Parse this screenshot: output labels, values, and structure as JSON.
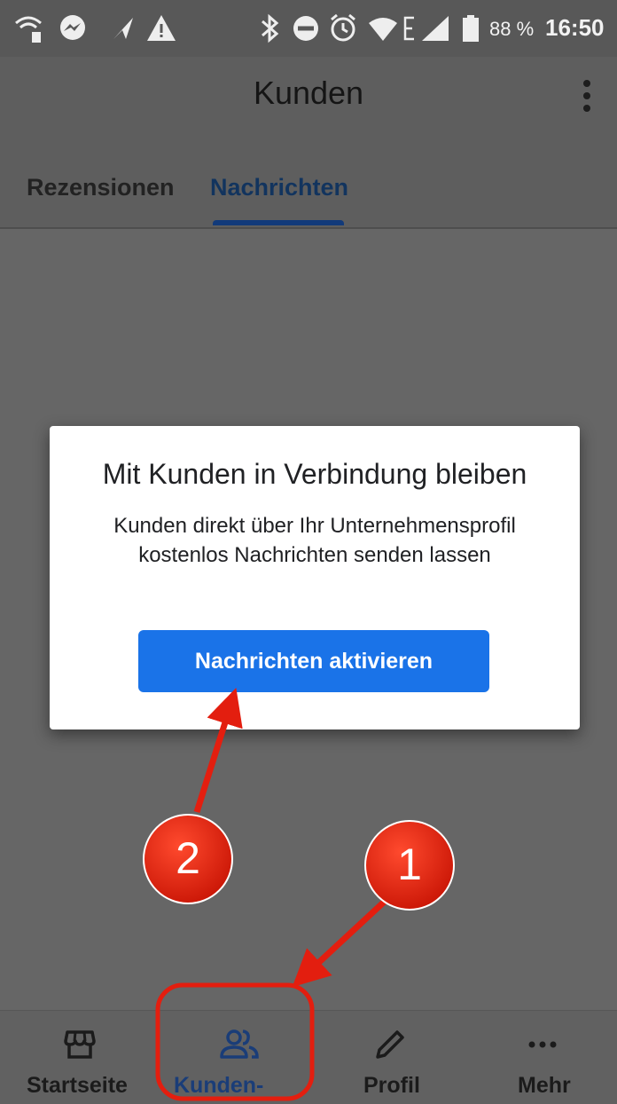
{
  "status_bar": {
    "battery": "88 %",
    "time": "16:50",
    "icons": [
      "wifi-calling-icon",
      "messenger-icon",
      "navigation-icon",
      "warning-icon",
      "bluetooth-icon",
      "do-not-disturb-icon",
      "alarm-icon",
      "wifi-icon",
      "network-e-icon",
      "signal-icon",
      "battery-icon"
    ]
  },
  "app_bar": {
    "title": "Kunden",
    "overflow_icon": "more-vert-icon"
  },
  "tabs": [
    {
      "label": "Rezensionen",
      "selected": false
    },
    {
      "label": "Nachrichten",
      "selected": true
    }
  ],
  "dialog": {
    "title": "Mit Kunden in Verbindung bleiben",
    "body": "Kunden direkt über Ihr Unternehmensprofil kostenlos Nachrichten senden lassen",
    "button_label": "Nachrichten aktivieren"
  },
  "bottom_nav": {
    "items": [
      {
        "label": "Startseite",
        "icon": "storefront-icon",
        "selected": false
      },
      {
        "label": "Kunden-",
        "icon": "people-icon",
        "selected": true
      },
      {
        "label": "Profil",
        "icon": "pencil-icon",
        "selected": false
      },
      {
        "label": "Mehr",
        "icon": "more-horiz-icon",
        "selected": false
      }
    ]
  },
  "annotations": {
    "badge_1": "1",
    "badge_2": "2"
  },
  "colors": {
    "primary": "#1a73e8",
    "selected_tab": "#12345e",
    "selected_nav": "#1a3d78",
    "annotation_red": "#e31e0f",
    "scrim": "#666666"
  }
}
